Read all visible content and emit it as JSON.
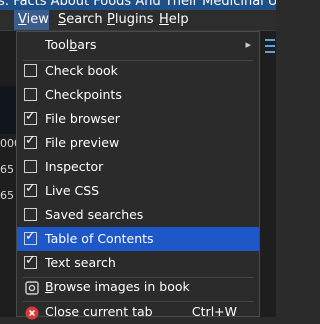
{
  "titlebar": {
    "text": "s: Facts About Foods And Their Medicinal Uses [EPUB]"
  },
  "menubar": {
    "items": [
      {
        "label": "View",
        "underline": "V",
        "rest": "iew"
      },
      {
        "label": "Search",
        "underline": "S",
        "rest": "earch"
      },
      {
        "label": "Plugins",
        "underline": "P",
        "rest": "lugins"
      },
      {
        "label": "Help",
        "underline": "H",
        "rest": "elp"
      }
    ]
  },
  "background": {
    "left_numbers": [
      "000",
      "65",
      "65"
    ]
  },
  "menu": {
    "toolbars_prefix": "Tool",
    "toolbars_underline": "b",
    "toolbars_suffix": "ars",
    "items": [
      {
        "label": "Check book",
        "checked": false
      },
      {
        "label": "Checkpoints",
        "checked": false
      },
      {
        "label": "File browser",
        "checked": true
      },
      {
        "label": "File preview",
        "checked": true
      },
      {
        "label": "Inspector",
        "checked": false
      },
      {
        "label": "Live CSS",
        "checked": true
      },
      {
        "label": "Saved searches",
        "checked": false
      },
      {
        "label": "Table of Contents",
        "checked": true
      },
      {
        "label": "Text search",
        "checked": true
      }
    ],
    "browse_images": {
      "label": "Browse images in book",
      "underline": "B",
      "rest": "rowse images in book"
    },
    "close_tab": {
      "label": "Close current tab",
      "shortcut": "Ctrl+W"
    },
    "submenu_arrow": "▸",
    "check_glyph": "✓"
  }
}
